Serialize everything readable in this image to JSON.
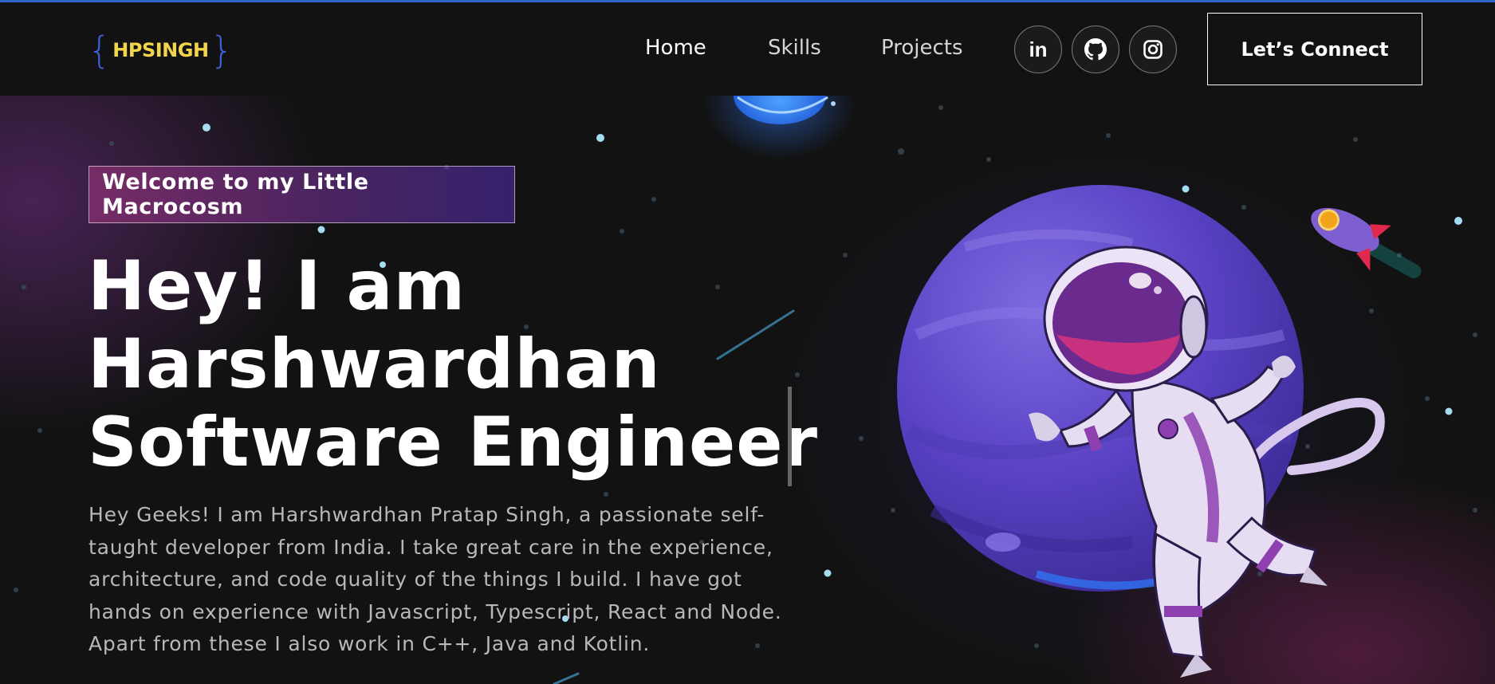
{
  "navbar": {
    "logo": {
      "open_brace": "{",
      "text": "HPSINGH",
      "close_brace": "}"
    },
    "links": [
      {
        "label": "Home",
        "active": true
      },
      {
        "label": "Skills",
        "active": false
      },
      {
        "label": "Projects",
        "active": false
      }
    ],
    "social": [
      {
        "name": "linkedin-icon",
        "glyph": "in"
      },
      {
        "name": "github-icon",
        "glyph": ""
      },
      {
        "name": "instagram-icon",
        "glyph": ""
      }
    ],
    "connect_label": "Let’s Connect"
  },
  "banner": {
    "tagline": "Welcome to my Little Macrocosm",
    "headline_line1": "Hey! I am",
    "headline_line2": "Harshwardhan",
    "headline_line3": "Software Engineer",
    "description": "Hey Geeks! I am Harshwardhan Pratap Singh, a passionate self-taught developer from India. I take great care in the experience, architecture, and code quality of the things I build. I have got hands on experience with Javascript, Typescript, React and Node. Apart from these I also work in C++, Java and Kotlin."
  },
  "colors": {
    "accent_blue": "#2f63c6",
    "logo_yellow": "#f2d54a",
    "tagline_gradient_start": "#aa367c",
    "tagline_gradient_end": "#4a2fbd",
    "planet_purple": "#5b3fc4"
  }
}
